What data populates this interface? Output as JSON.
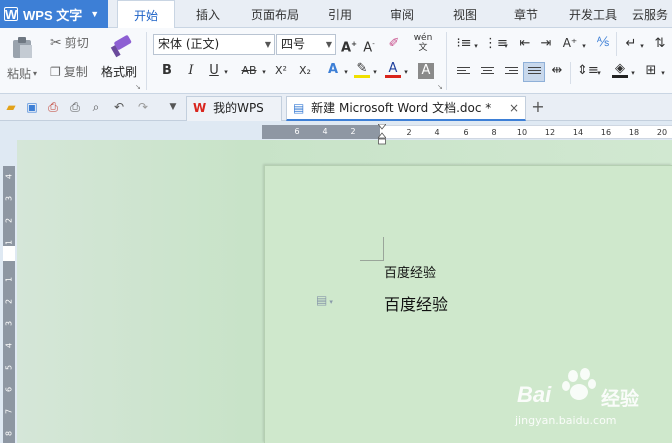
{
  "app": {
    "name": "WPS 文字",
    "logo_letter": "W"
  },
  "menu": {
    "tabs": [
      "开始",
      "插入",
      "页面布局",
      "引用",
      "审阅",
      "视图",
      "章节",
      "开发工具",
      "云服务"
    ],
    "active_tab": "开始"
  },
  "ribbon": {
    "clipboard": {
      "paste": "粘贴",
      "cut": "剪切",
      "copy": "复制",
      "format_painter": "格式刷"
    },
    "font": {
      "family": "宋体 (正文)",
      "size": "四号"
    },
    "format_buttons": [
      "B",
      "I",
      "U",
      "AB",
      "X²",
      "X₂",
      "A",
      "A",
      "A"
    ],
    "grow_font": "A⁺",
    "shrink_font": "A⁻",
    "phonetic": "wén"
  },
  "tabs": {
    "my_wps": "我的WPS",
    "document": "新建 Microsoft Word 文档.doc *",
    "close": "×",
    "new_tab": "+"
  },
  "ruler": {
    "top_left_numbers": [
      "6",
      "4",
      "2"
    ],
    "top_right_numbers": [
      "2",
      "4",
      "6",
      "8",
      "10",
      "12",
      "14",
      "16",
      "18",
      "20"
    ],
    "left_numbers": [
      "4",
      "3",
      "2",
      "1",
      "1",
      "2",
      "3",
      "4",
      "5",
      "6",
      "7",
      "8"
    ]
  },
  "document": {
    "line1": "百度经验",
    "line2": "百度经验"
  },
  "watermark": {
    "brand": "Bai",
    "brand2": "经验",
    "url": "jingyan.baidu.com"
  },
  "colors": {
    "accent": "#3d7fd6",
    "page": "#cfe8cc",
    "workspace": "#c8e3c8",
    "wps_red": "#d9251d"
  }
}
